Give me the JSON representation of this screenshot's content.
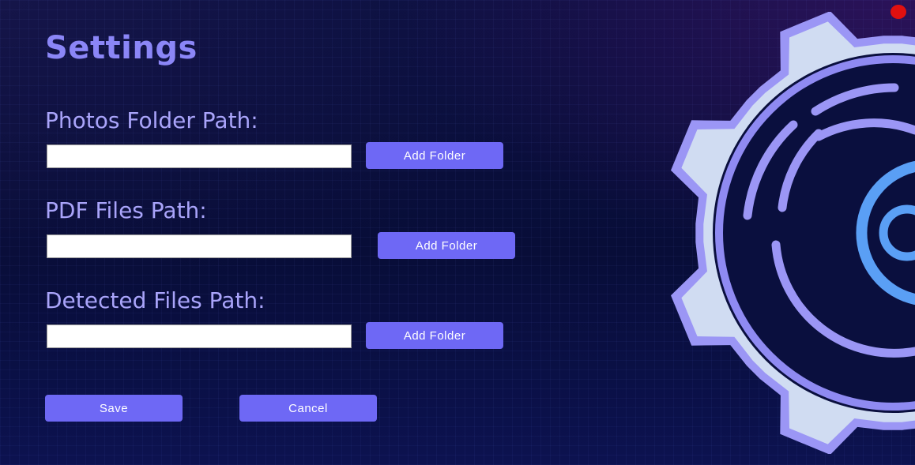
{
  "window": {
    "title": "Settings"
  },
  "fields": [
    {
      "label": "Photos Folder Path:",
      "value": "",
      "button_label": "Add Folder"
    },
    {
      "label": "PDF Files Path:",
      "value": "",
      "button_label": "Add Folder"
    },
    {
      "label": "Detected Files Path:",
      "value": "",
      "button_label": "Add Folder"
    }
  ],
  "actions": {
    "save_label": "Save",
    "cancel_label": "Cancel"
  },
  "icons": {
    "close": "close-dot-icon",
    "decoration": "gear-icon"
  },
  "colors": {
    "accent": "#6e68f5",
    "title": "#8b86f7",
    "label": "#a9a4fa",
    "close": "#e01010",
    "gear_outline": "#9b96f5",
    "gear_fill": "#d0dcf2",
    "gear_core": "#5a9ff5"
  }
}
